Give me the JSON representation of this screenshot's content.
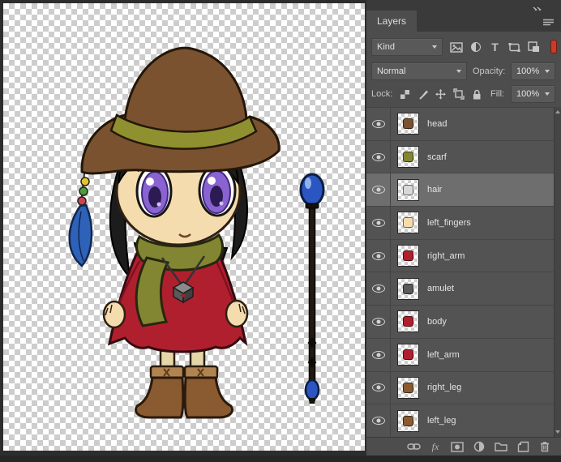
{
  "panel": {
    "tab_title": "Layers",
    "filter_row": {
      "kind_label": "Kind",
      "type_glyph": "T",
      "filter_toggle_color": "#cf3a28"
    },
    "blend_row": {
      "blend_mode": "Normal",
      "opacity_label": "Opacity:",
      "opacity_value": "100%"
    },
    "lock_row": {
      "lock_label": "Lock:",
      "fill_label": "Fill:",
      "fill_value": "100%"
    },
    "layers": [
      {
        "name": "head",
        "visible": true,
        "selected": false,
        "thumb_color": "#7a5230"
      },
      {
        "name": "scarf",
        "visible": true,
        "selected": false,
        "thumb_color": "#828633"
      },
      {
        "name": "hair",
        "visible": true,
        "selected": true,
        "thumb_color": "#d9d9d9"
      },
      {
        "name": "left_fingers",
        "visible": true,
        "selected": false,
        "thumb_color": "#f5dcae"
      },
      {
        "name": "right_arm",
        "visible": true,
        "selected": false,
        "thumb_color": "#b01f2e"
      },
      {
        "name": "amulet",
        "visible": true,
        "selected": false,
        "thumb_color": "#5a5a5a"
      },
      {
        "name": "body",
        "visible": true,
        "selected": false,
        "thumb_color": "#b01f2e"
      },
      {
        "name": "left_arm",
        "visible": true,
        "selected": false,
        "thumb_color": "#b01f2e"
      },
      {
        "name": "right_leg",
        "visible": true,
        "selected": false,
        "thumb_color": "#8a5a30"
      },
      {
        "name": "left_leg",
        "visible": true,
        "selected": false,
        "thumb_color": "#8a5a30"
      }
    ],
    "footer": {
      "fx_label": "fx"
    }
  },
  "colors": {
    "panel_bg": "#4d4d4d",
    "row_selected": "#6e6e6e",
    "canvas_checker": "#cdcdcd",
    "filter_toggle": "#cf3a28"
  }
}
